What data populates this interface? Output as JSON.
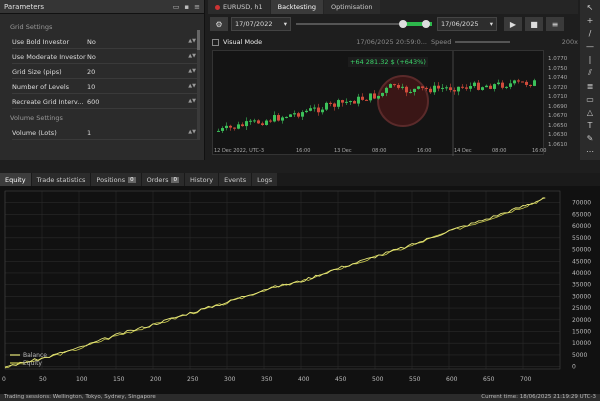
{
  "params": {
    "title": "Parameters",
    "section1": "Grid Settings",
    "rows": [
      {
        "label": "Use Bold Investor",
        "value": "No"
      },
      {
        "label": "Use Moderate Investor",
        "value": "No"
      },
      {
        "label": "Grid Size (pips)",
        "value": "20"
      },
      {
        "label": "Number of Levels",
        "value": "10"
      },
      {
        "label": "Recreate Grid Interv...",
        "value": "600"
      }
    ],
    "section2": "Volume Settings",
    "volume": {
      "label": "Volume (Lots)",
      "value": "1"
    }
  },
  "tabs": [
    "EURUSD, h1",
    "Backtesting",
    "Optimisation"
  ],
  "toolbar": {
    "start_date": "17/07/2022",
    "end_date": "17/06/2025"
  },
  "visual": {
    "label": "Visual Mode",
    "datetime": "17/06/2025 20:59:0...",
    "speed_label": "Speed",
    "speed_value": "200x"
  },
  "chart": {
    "profit": "+64 281.32 $ (+643%)",
    "price_ticks": [
      "1.0770",
      "1.0750",
      "1.0740",
      "1.0720",
      "1.0710",
      "1.0690",
      "1.0670",
      "1.0650",
      "1.0630",
      "1.0610"
    ],
    "time_ticks": [
      "12 Dec 2022, UTC-3",
      "16:00",
      "13 Dec",
      "08:00",
      "16:00",
      "14 Dec",
      "08:00",
      "16:00"
    ]
  },
  "bottom_tabs": [
    {
      "label": "Equity"
    },
    {
      "label": "Trade statistics"
    },
    {
      "label": "Positions",
      "badge": "0"
    },
    {
      "label": "Orders",
      "badge": "0"
    },
    {
      "label": "History"
    },
    {
      "label": "Events"
    },
    {
      "label": "Logs"
    }
  ],
  "chart_data": {
    "type": "line",
    "series": [
      {
        "name": "Balance",
        "color": "#e8e87a"
      },
      {
        "name": "Equity",
        "color": "#c8c850"
      }
    ],
    "x": [
      0,
      50,
      100,
      150,
      200,
      250,
      300,
      350,
      400,
      450,
      500,
      550,
      600,
      650,
      700,
      730
    ],
    "values": [
      0,
      3500,
      8000,
      13500,
      18000,
      23000,
      27500,
      33000,
      36500,
      42000,
      47000,
      52000,
      58000,
      63000,
      68500,
      72000
    ],
    "xticks": [
      0,
      50,
      100,
      150,
      200,
      250,
      300,
      350,
      400,
      450,
      500,
      550,
      600,
      650,
      700
    ],
    "yticks": [
      0,
      5000,
      10000,
      15000,
      20000,
      25000,
      30000,
      35000,
      40000,
      45000,
      50000,
      55000,
      60000,
      65000,
      70000
    ],
    "xlim": [
      0,
      750
    ],
    "ylim": [
      -1000,
      75000
    ],
    "grid": true,
    "legend": "bottom-left"
  },
  "status": {
    "left": "Trading sessions: Wellington, Tokyo, Sydney, Singapore",
    "right": "Current time: 18/06/2025 21:19:29  UTC-3"
  }
}
